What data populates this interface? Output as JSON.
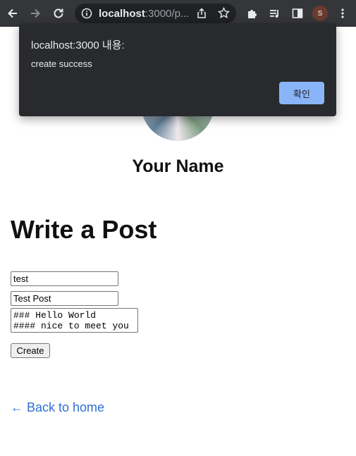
{
  "browser": {
    "url_host": "localhost",
    "url_rest": ":3000/p...",
    "profile_initial": "S"
  },
  "page": {
    "profile_name": "Your Name",
    "heading": "Write a Post",
    "form": {
      "id_value": "test",
      "title_value": "Test Post",
      "content_value": "### Hello World\n#### nice to meet you",
      "submit_label": "Create"
    },
    "back_link": "← Back to home"
  },
  "dialog": {
    "title": "localhost:3000 내용:",
    "message": "create success",
    "ok_label": "확인"
  },
  "colors": {
    "toolbar": "#35363a",
    "dialog_bg": "#292a2d",
    "dialog_button": "#8ab4f8",
    "link": "#2f6fd6"
  }
}
